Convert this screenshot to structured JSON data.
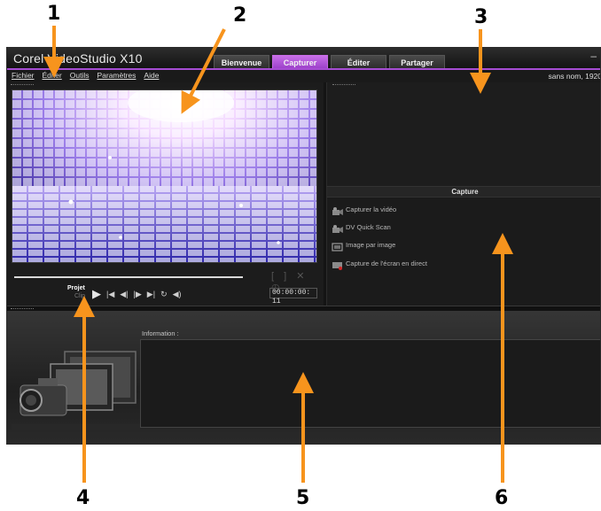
{
  "app": {
    "logo": "Corel VideoStudio X10",
    "minimize_glyph": "–",
    "tabs": [
      {
        "label": "Bienvenue",
        "active": false
      },
      {
        "label": "Capturer",
        "active": true
      },
      {
        "label": "Éditer",
        "active": false
      },
      {
        "label": "Partager",
        "active": false
      }
    ],
    "accent": "#a64cd3",
    "project_name": "sans nom, 1920"
  },
  "menu": [
    {
      "label": "Fichier"
    },
    {
      "label": "Éditer"
    },
    {
      "label": "Outils"
    },
    {
      "label": "Paramètres"
    },
    {
      "label": "Aide"
    }
  ],
  "player": {
    "mode_project": "Projet",
    "mode_clip": "Clip",
    "timecode": "00:00:00: 11",
    "icons": [
      "play-icon",
      "home-icon",
      "prev-frame-icon",
      "next-frame-icon",
      "end-icon",
      "repeat-icon",
      "volume-icon"
    ]
  },
  "capture": {
    "title": "Capture",
    "items": [
      {
        "label": "Capturer la vidéo",
        "icon": "video-capture-icon"
      },
      {
        "label": "DV Quick Scan",
        "icon": "dv-scan-icon"
      },
      {
        "label": "Image par image",
        "icon": "frame-by-frame-icon"
      },
      {
        "label": "Capture de l'écran en direct",
        "icon": "screen-capture-icon"
      }
    ]
  },
  "info": {
    "label": "Information :"
  },
  "annotations": [
    {
      "number": "1",
      "target": "menu-bar"
    },
    {
      "number": "2",
      "target": "player-panel"
    },
    {
      "number": "3",
      "target": "library-panel"
    },
    {
      "number": "4",
      "target": "navigation-panel"
    },
    {
      "number": "5",
      "target": "information-panel"
    },
    {
      "number": "6",
      "target": "options-panel"
    }
  ],
  "colors": {
    "annotation_arrow": "#f7941d"
  }
}
